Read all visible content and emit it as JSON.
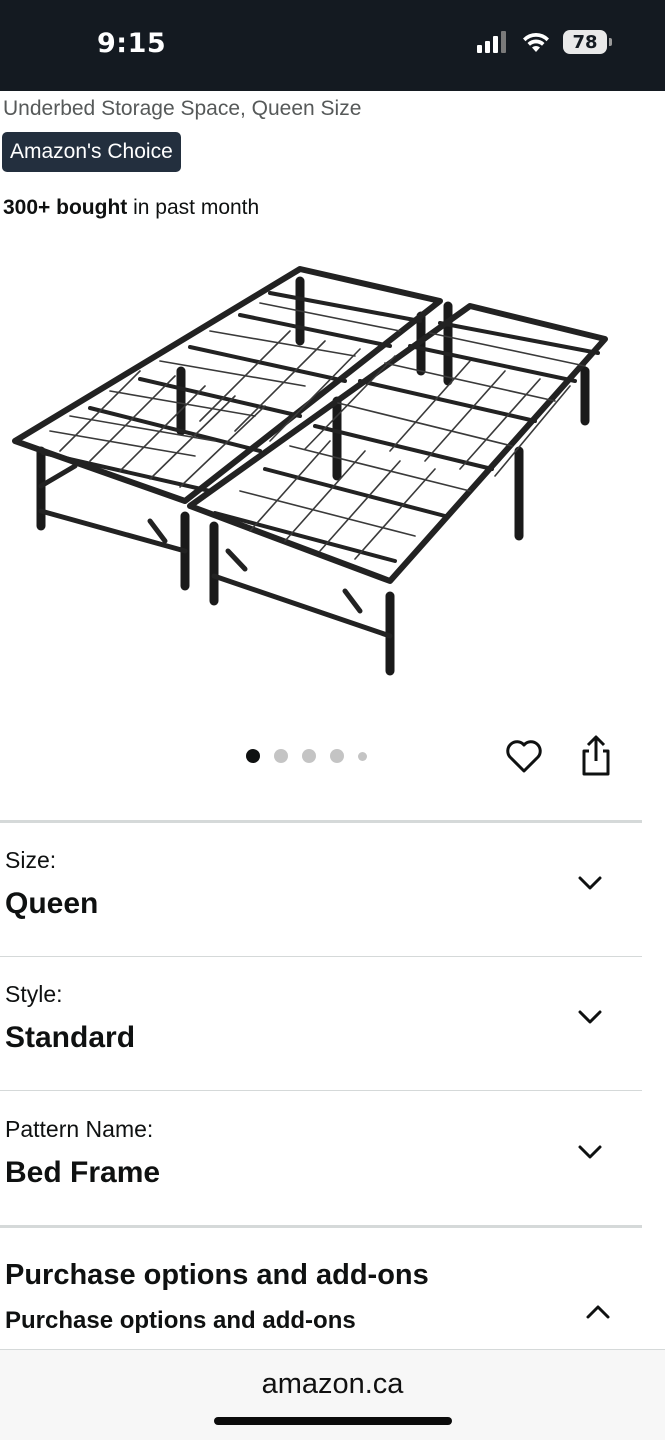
{
  "status_bar": {
    "time": "9:15",
    "battery": "78",
    "icons": [
      "signal-icon",
      "wifi-icon",
      "battery-icon"
    ]
  },
  "product": {
    "subtitle": "Underbed Storage Space, Queen Size",
    "badge": "Amazon's Choice",
    "bought_bold": "300+ bought",
    "bought_rest": " in past month",
    "image_icon": "bed-frame-image",
    "carousel": {
      "count": 5,
      "active_index": 0
    }
  },
  "options": [
    {
      "label": "Size:",
      "value": "Queen"
    },
    {
      "label": "Style:",
      "value": "Standard"
    },
    {
      "label": "Pattern Name:",
      "value": "Bed Frame"
    }
  ],
  "purchase": {
    "title": "Purchase options and add-ons",
    "subtitle": "Purchase options and add-ons"
  },
  "browser": {
    "url": "amazon.ca"
  },
  "colors": {
    "status_bar_bg": "#141a21",
    "badge_bg": "#232f3e",
    "divider": "#d5d9d9"
  }
}
